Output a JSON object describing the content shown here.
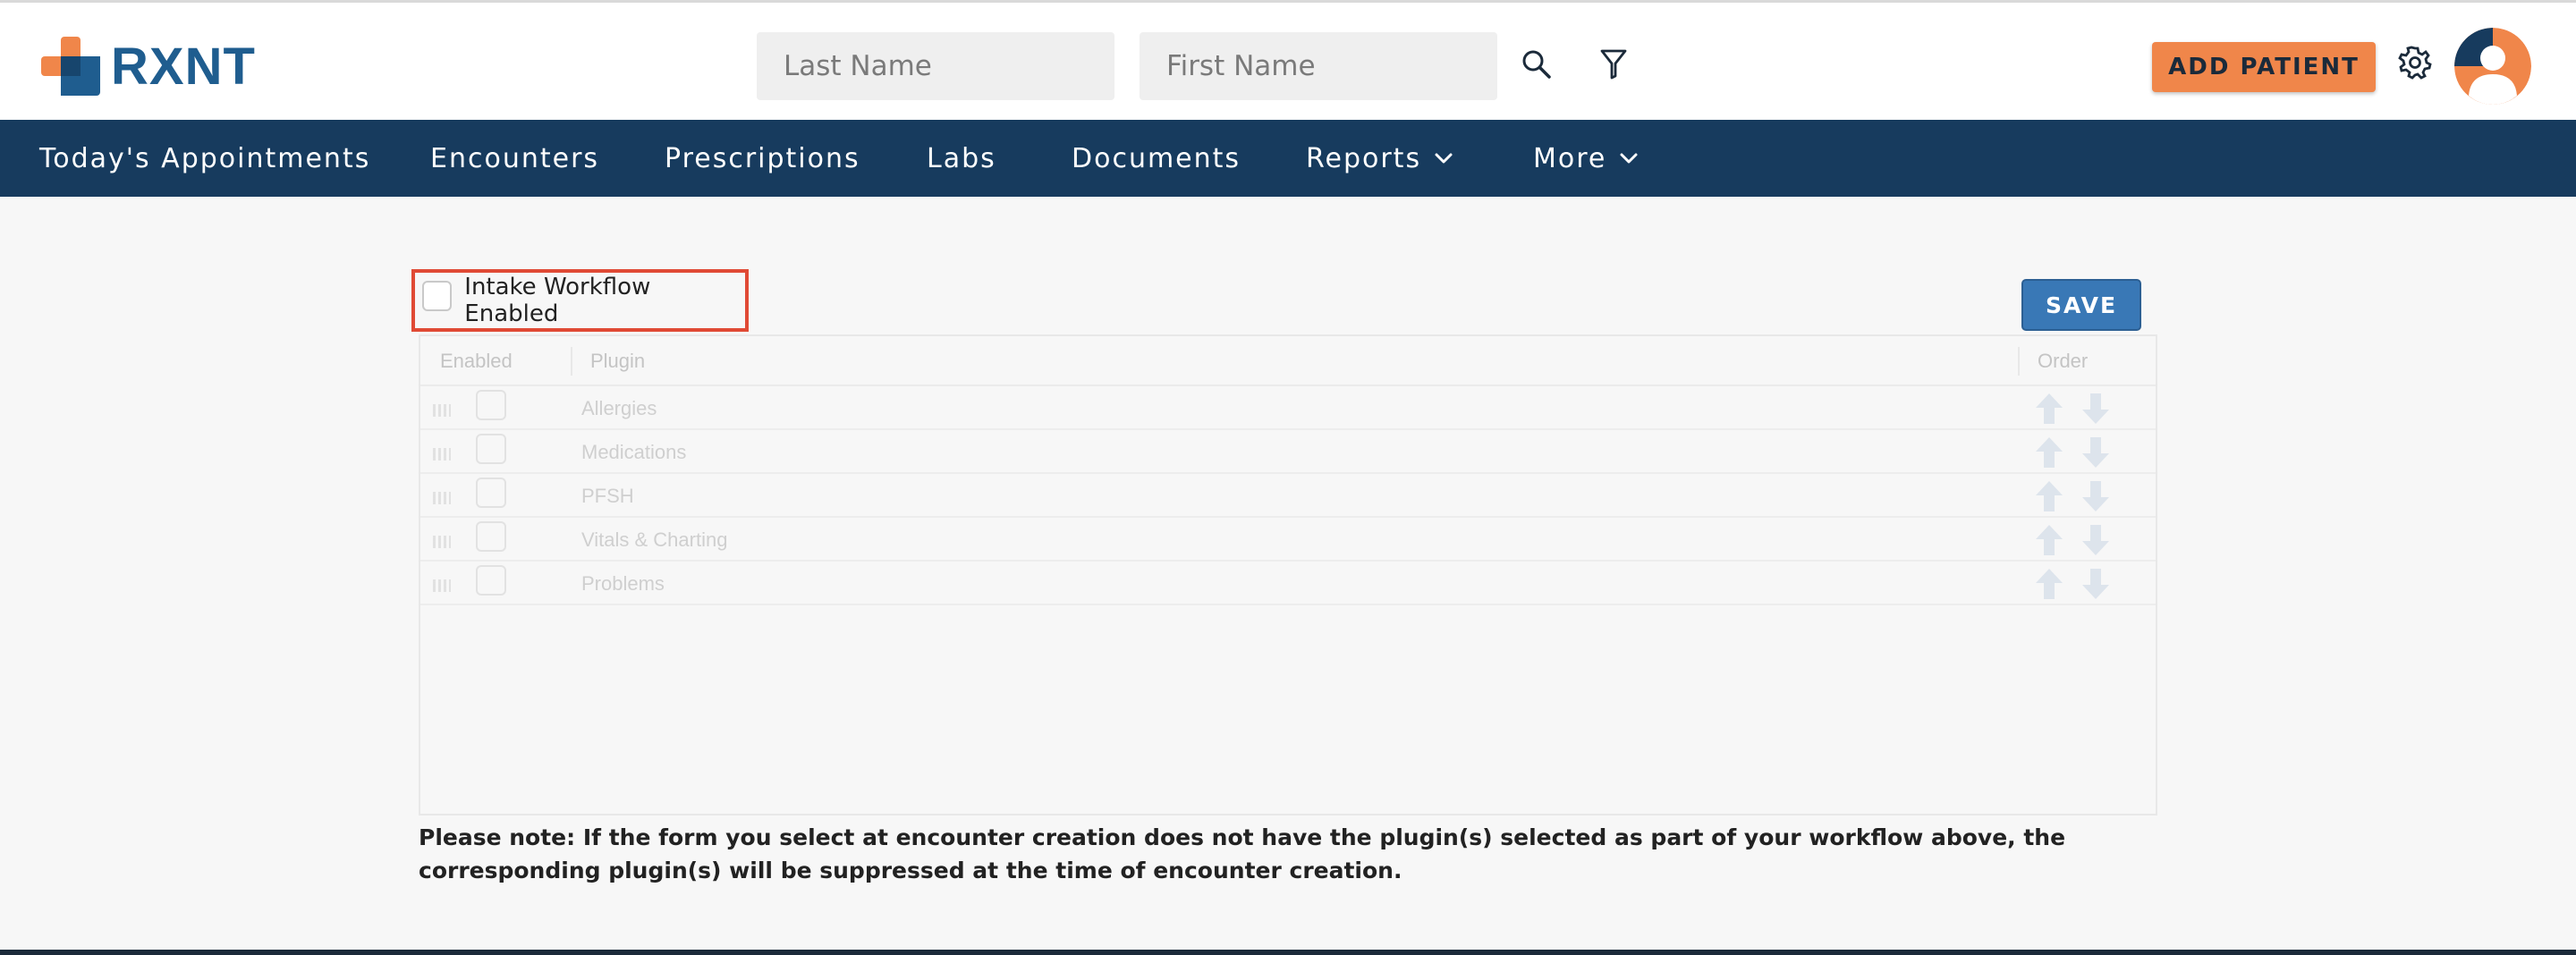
{
  "app": {
    "logo_text": "RXNT",
    "brand_colors": {
      "orange": "#f0864a",
      "navy": "#173b5e",
      "blue": "#1f5d8f"
    }
  },
  "header": {
    "last_name_placeholder": "Last Name",
    "first_name_placeholder": "First Name",
    "search_icon": "search-icon",
    "filter_icon": "filter-icon",
    "add_patient_label": "ADD PATIENT",
    "settings_icon": "gear-icon",
    "avatar_icon": "user-avatar-icon"
  },
  "nav": {
    "items": [
      {
        "label": "Today's Appointments",
        "has_dropdown": false
      },
      {
        "label": "Encounters",
        "has_dropdown": false
      },
      {
        "label": "Prescriptions",
        "has_dropdown": false
      },
      {
        "label": "Labs",
        "has_dropdown": false
      },
      {
        "label": "Documents",
        "has_dropdown": false
      },
      {
        "label": "Reports",
        "has_dropdown": true
      },
      {
        "label": "More",
        "has_dropdown": true
      }
    ]
  },
  "intake": {
    "label": "Intake Workflow Enabled",
    "checked": false,
    "highlight_color": "#e04a35"
  },
  "save_label": "SAVE",
  "grid": {
    "columns": [
      "Enabled",
      "Plugin",
      "Order"
    ],
    "rows": [
      {
        "plugin": "Allergies",
        "enabled": false
      },
      {
        "plugin": "Medications",
        "enabled": false
      },
      {
        "plugin": "PFSH",
        "enabled": false
      },
      {
        "plugin": "Vitals & Charting",
        "enabled": false
      },
      {
        "plugin": "Problems",
        "enabled": false
      }
    ]
  },
  "note": "Please note: If the form you select at encounter creation does not have the plugin(s) selected as part of your workflow above, the corresponding plugin(s) will be suppressed at the time of encounter creation."
}
